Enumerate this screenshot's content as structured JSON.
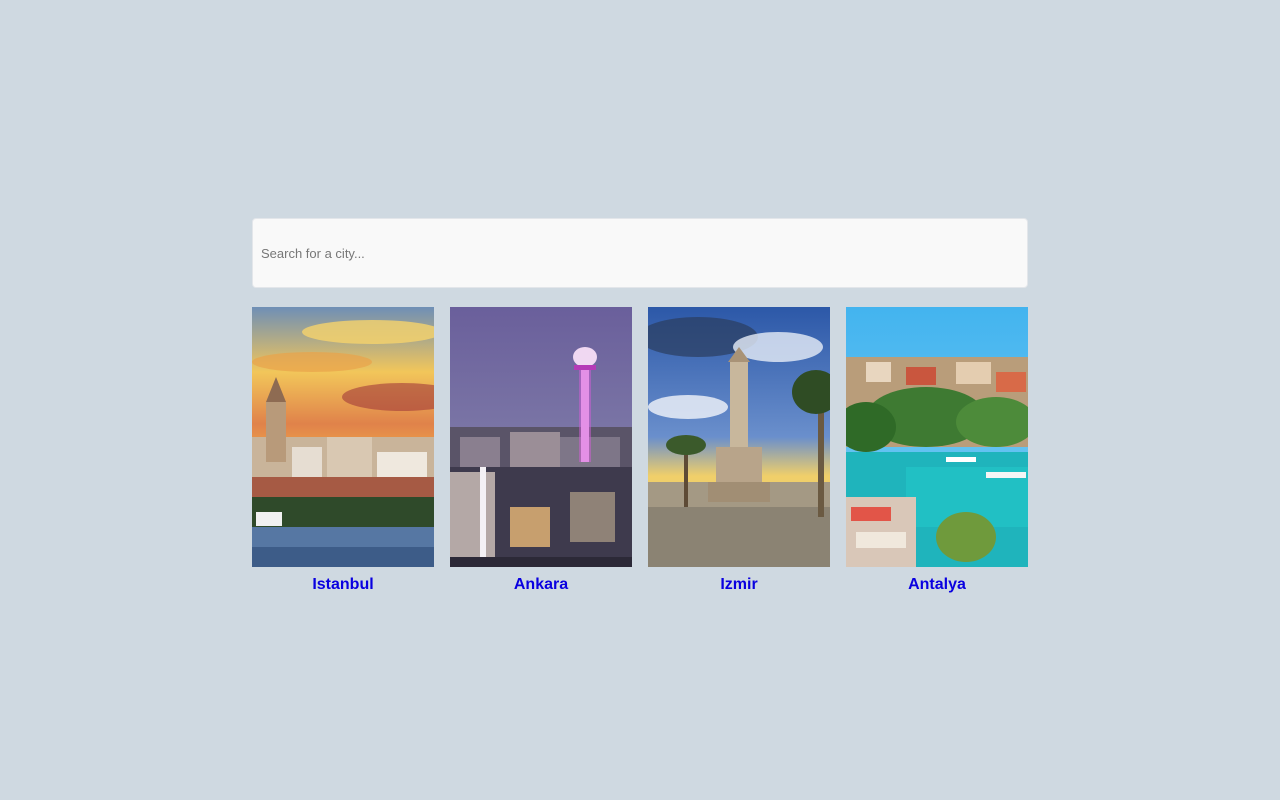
{
  "search": {
    "placeholder": "Search for a city..."
  },
  "cities": [
    {
      "name": "Istanbul",
      "image": "istanbul-sunset-skyline-with-galata-tower"
    },
    {
      "name": "Ankara",
      "image": "ankara-night-skyline-with-atakule-tower"
    },
    {
      "name": "Izmir",
      "image": "izmir-clock-tower-square-with-palms"
    },
    {
      "name": "Antalya",
      "image": "antalya-old-town-harbor-with-boats"
    }
  ],
  "colors": {
    "background": "#cfd9e1",
    "link": "#0a00e0",
    "search_bg": "#f9f9f9"
  }
}
